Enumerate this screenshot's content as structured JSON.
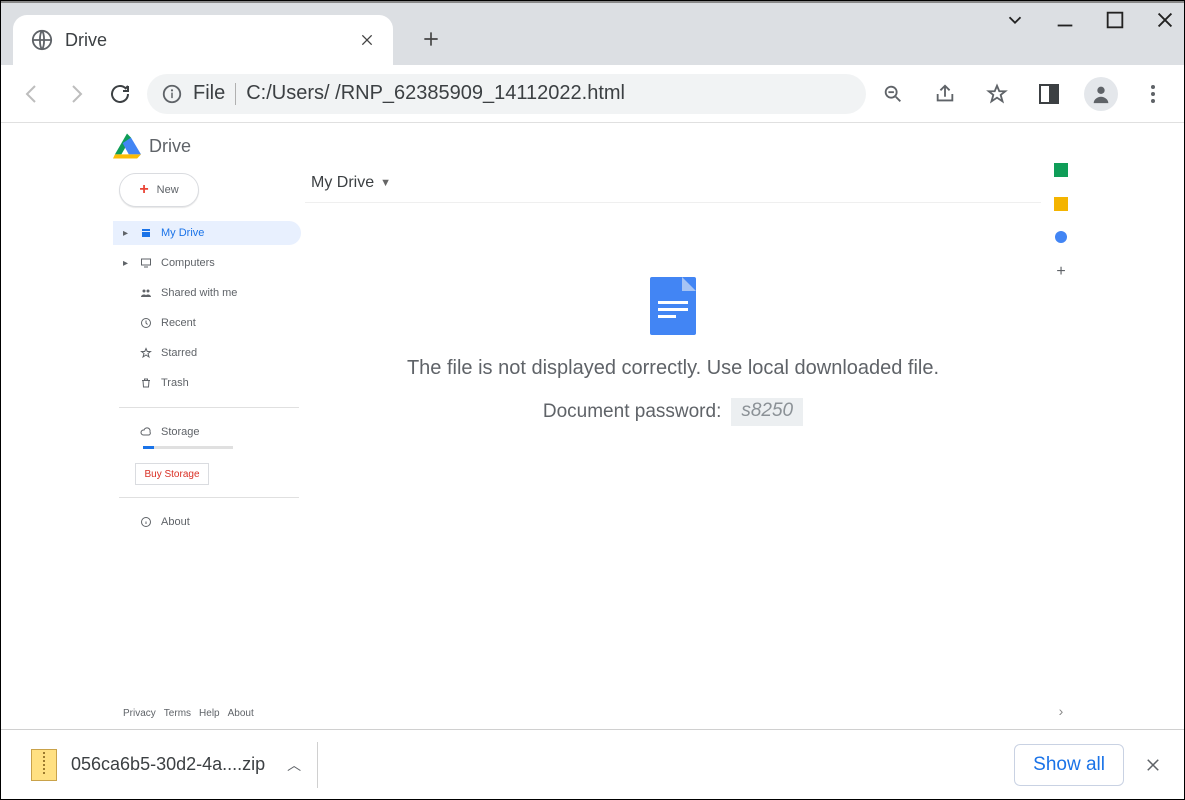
{
  "tab": {
    "title": "Drive"
  },
  "address": {
    "scheme": "File",
    "path": "C:/Users/      /RNP_62385909_14112022.html"
  },
  "drive": {
    "brand": "Drive",
    "new_button": "New",
    "nav": {
      "my_drive": "My Drive",
      "computers": "Computers",
      "shared": "Shared with me",
      "recent": "Recent",
      "starred": "Starred",
      "trash": "Trash",
      "storage": "Storage",
      "buy_storage": "Buy Storage",
      "about": "About"
    },
    "breadcrumb": "My Drive",
    "content": {
      "line1": "The file is not displayed correctly. Use local downloaded file.",
      "line2_label": "Document password:",
      "password": "s8250"
    },
    "footer": {
      "privacy": "Privacy",
      "terms": "Terms",
      "help": "Help",
      "about": "About"
    }
  },
  "download": {
    "filename": "056ca6b5-30d2-4a....zip",
    "show_all": "Show all"
  }
}
